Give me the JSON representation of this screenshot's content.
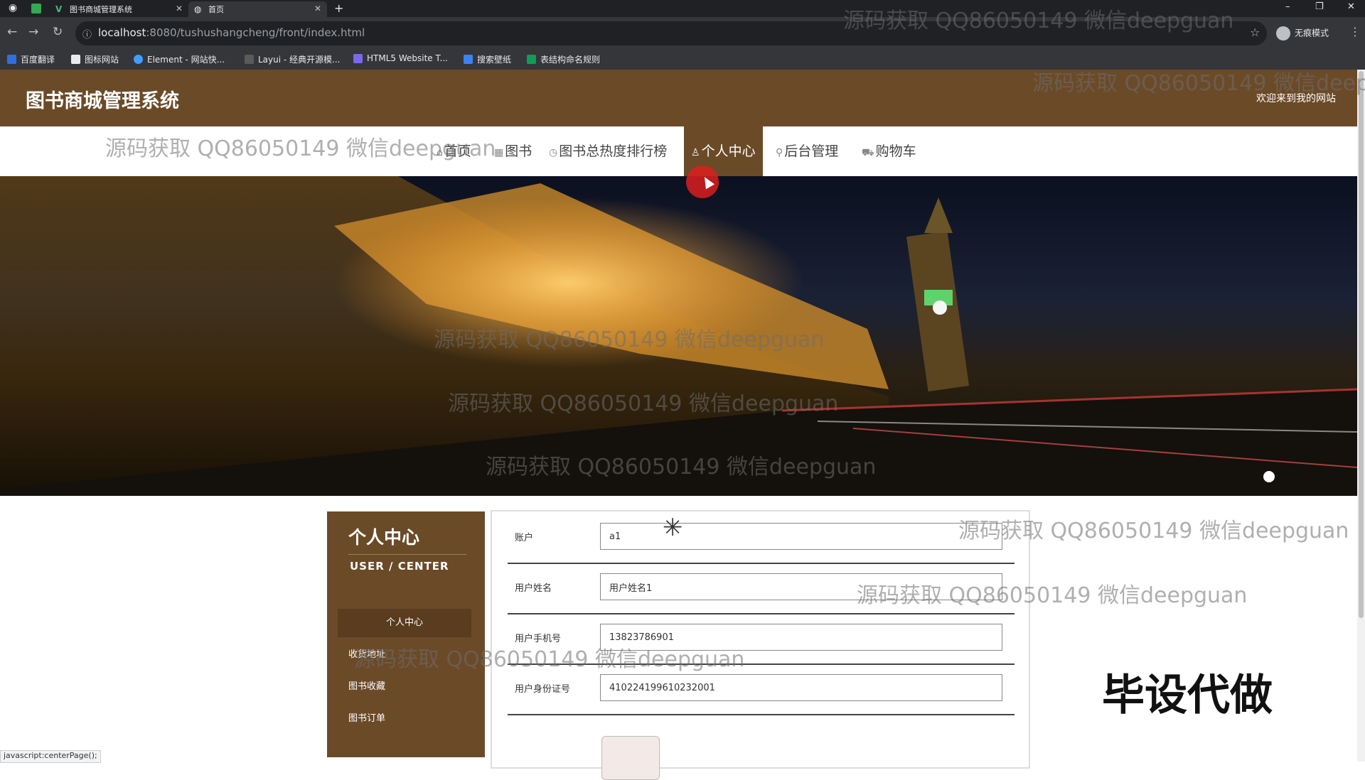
{
  "browser": {
    "tabs": [
      {
        "label": "图书商城管理系统",
        "active": false
      },
      {
        "label": "首页",
        "active": true
      }
    ],
    "new_tab": "+",
    "url_host": "localhost",
    "url_path": ":8080/tushushangcheng/front/index.html",
    "profile": "无痕模式",
    "bookmarks": [
      "百度翻译",
      "图标网站",
      "Element - 网站快...",
      "Layui - 经典开源模...",
      "HTML5 Website T...",
      "搜索壁纸",
      "表结构命名规则"
    ]
  },
  "site": {
    "title": "图书商城管理系统",
    "welcome": "欢迎来到我的网站"
  },
  "nav": [
    {
      "label": "首页",
      "active": false
    },
    {
      "label": "图书",
      "active": false
    },
    {
      "label": "图书总热度排行榜",
      "active": false
    },
    {
      "label": "个人中心",
      "active": true
    },
    {
      "label": "后台管理",
      "active": false
    },
    {
      "label": "购物车",
      "active": false
    }
  ],
  "banner": {
    "slides": 3,
    "active_slide": 2
  },
  "sidebar": {
    "title": "个人中心",
    "subtitle": "USER / CENTER",
    "items": [
      {
        "label": "个人中心",
        "active": true
      },
      {
        "label": "收货地址",
        "active": false
      },
      {
        "label": "图书收藏",
        "active": false
      },
      {
        "label": "图书订单",
        "active": false
      }
    ]
  },
  "form": {
    "fields": [
      {
        "label": "账户",
        "value": "a1"
      },
      {
        "label": "用户姓名",
        "value": "用户姓名1"
      },
      {
        "label": "用户手机号",
        "value": "13823786901"
      },
      {
        "label": "用户身份证号",
        "value": "410224199610232001"
      }
    ]
  },
  "promo": "毕设代做",
  "status_bar": "javascript:centerPage();",
  "watermark": "源码获取 QQ86050149 微信deepguan",
  "colors": {
    "brand": "#6b4a28",
    "brand_dark": "#5a3c1e"
  }
}
